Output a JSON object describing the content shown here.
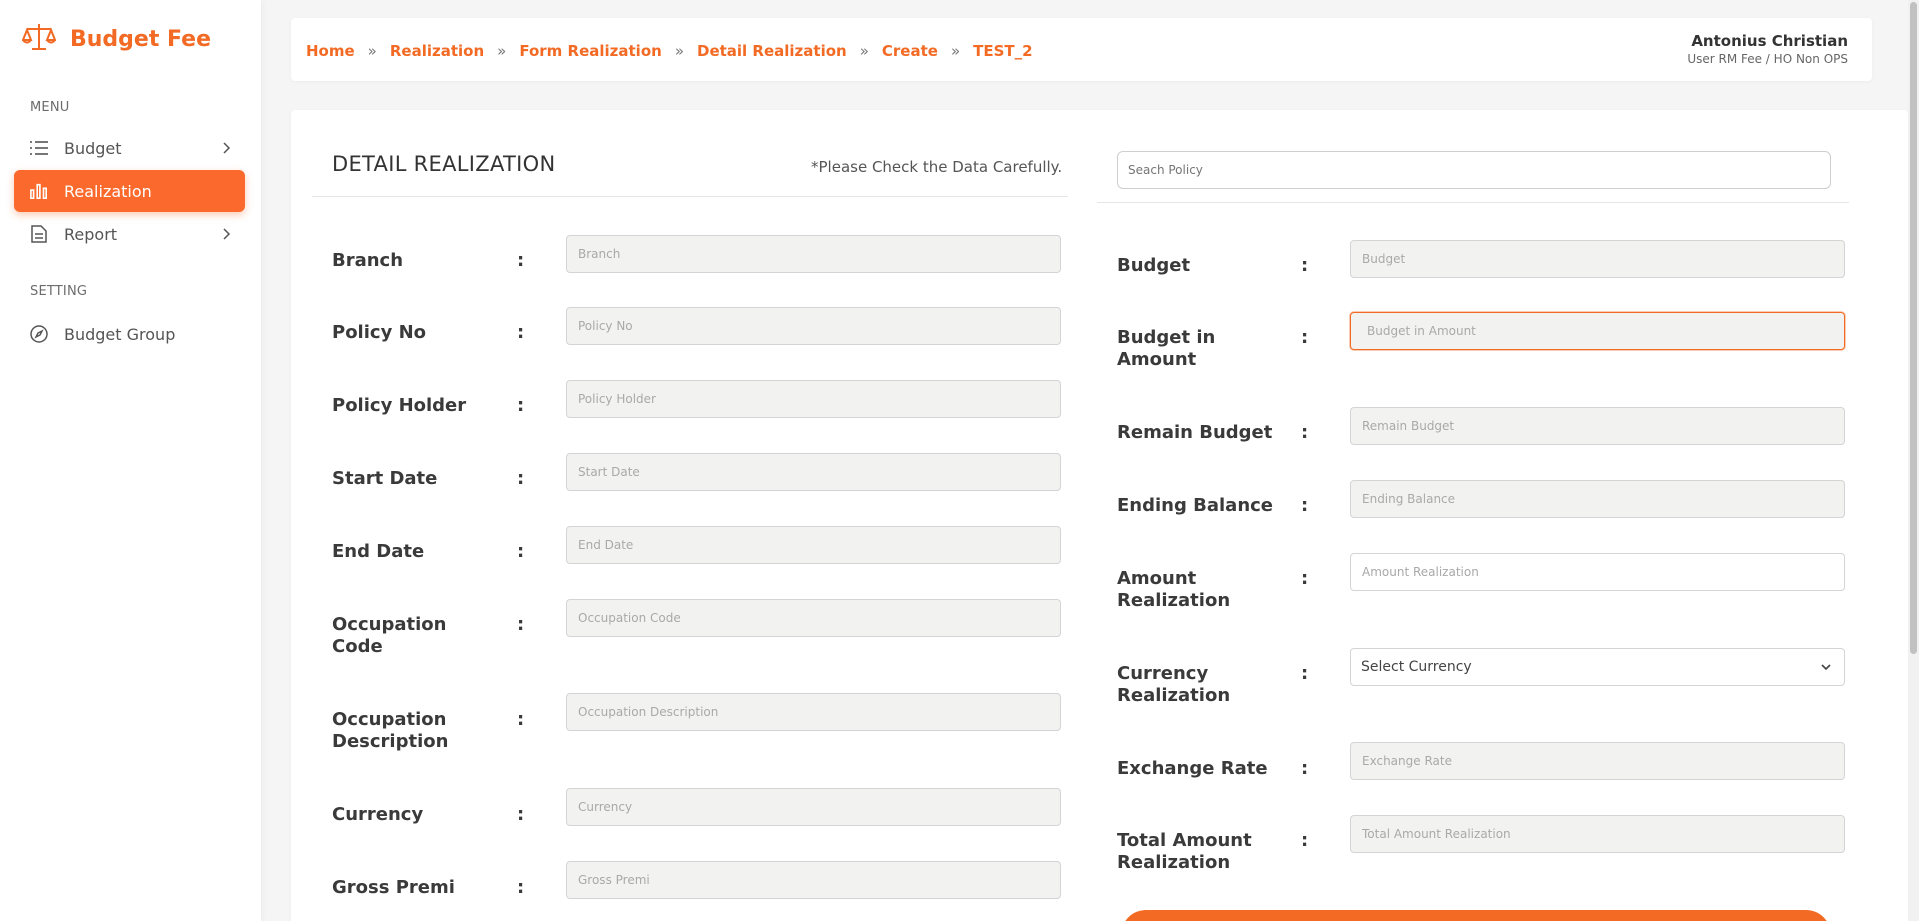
{
  "app": {
    "name": "Budget Fee",
    "brand_color": "#f26a23",
    "logo_icon": "scale-icon"
  },
  "sidebar": {
    "menu_label": "MENU",
    "setting_label": "SETTING",
    "items": [
      {
        "label": "Budget",
        "icon": "list-icon",
        "has_children": true
      },
      {
        "label": "Realization",
        "icon": "bar-chart-icon",
        "active": true
      },
      {
        "label": "Report",
        "icon": "document-icon",
        "has_children": true
      }
    ],
    "setting_items": [
      {
        "label": "Budget Group",
        "icon": "compass-icon"
      }
    ]
  },
  "breadcrumb": [
    "Home",
    "Realization",
    "Form Realization",
    "Detail Realization",
    "Create",
    "TEST_2"
  ],
  "breadcrumb_sep": "»",
  "user": {
    "name": "Antonius Christian",
    "role": "User RM Fee / HO Non OPS"
  },
  "form": {
    "title": "DETAIL REALIZATION",
    "note": "*Please Check the Data Carefully.",
    "search_placeholder": "Seach Policy",
    "colon": ":",
    "left": [
      {
        "label": "Branch",
        "placeholder": "Branch"
      },
      {
        "label": "Policy No",
        "placeholder": "Policy No"
      },
      {
        "label": "Policy Holder",
        "placeholder": "Policy Holder"
      },
      {
        "label": "Start Date",
        "placeholder": "Start Date"
      },
      {
        "label": "End Date",
        "placeholder": "End Date"
      },
      {
        "label": "Occupation Code",
        "placeholder": "Occupation Code"
      },
      {
        "label": "Occupation Description",
        "placeholder": "Occupation Description"
      },
      {
        "label": "Currency",
        "placeholder": "Currency"
      },
      {
        "label": "Gross Premi",
        "placeholder": "Gross Premi"
      }
    ],
    "right": [
      {
        "label": "Budget",
        "placeholder": "Budget"
      },
      {
        "label": "Budget in Amount",
        "placeholder": "Budget in Amount"
      },
      {
        "label": "Remain Budget",
        "placeholder": "Remain Budget"
      },
      {
        "label": "Ending Balance",
        "placeholder": "Ending Balance"
      },
      {
        "label": "Amount Realization",
        "placeholder": "Amount Realization"
      },
      {
        "label": "Currency Realization",
        "select_value": "Select Currency"
      },
      {
        "label": "Exchange Rate",
        "placeholder": "Exchange Rate"
      },
      {
        "label": "Total Amount Realization",
        "placeholder": "Total Amount Realization"
      }
    ]
  }
}
